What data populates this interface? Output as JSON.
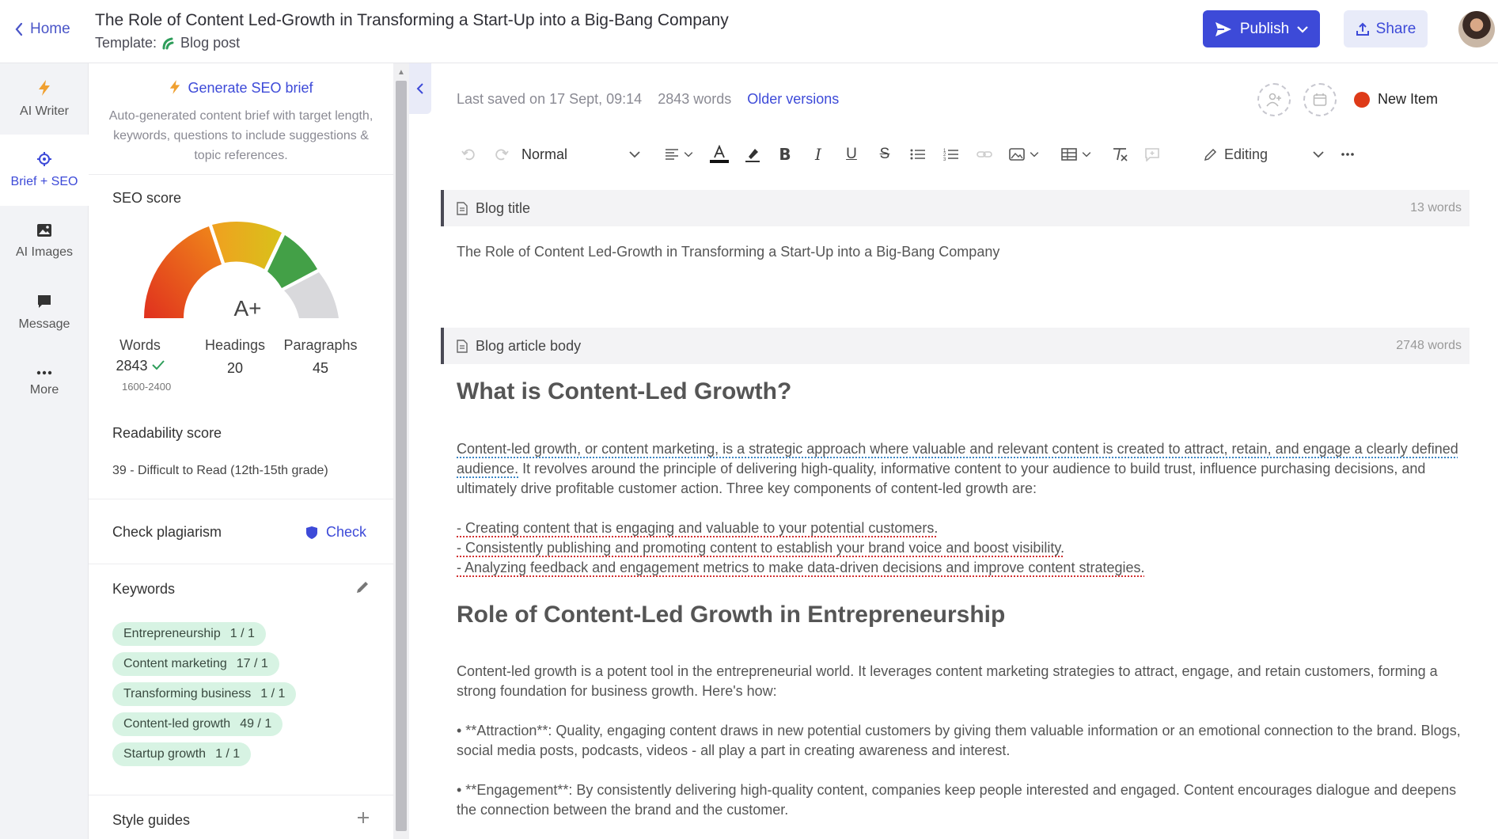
{
  "header": {
    "home_label": "Home",
    "doc_title": "The Role of Content Led-Growth in Transforming a Start-Up into a Big-Bang Company",
    "template_prefix": "Template:",
    "template_name": "Blog post",
    "publish_label": "Publish",
    "share_label": "Share"
  },
  "rail": {
    "items": [
      {
        "label": "AI Writer",
        "icon": "bolt-icon"
      },
      {
        "label": "Brief + SEO",
        "icon": "target-icon"
      },
      {
        "label": "AI Images",
        "icon": "image-icon"
      },
      {
        "label": "Message",
        "icon": "chat-icon"
      },
      {
        "label": "More",
        "icon": "more-icon"
      }
    ],
    "active": "Brief + SEO"
  },
  "panel": {
    "generate_label": "Generate SEO brief",
    "generate_desc": "Auto-generated content brief with target length, keywords, questions to include suggestions & topic references.",
    "seo_title": "SEO score",
    "grade": "A+",
    "stats": {
      "words_label": "Words",
      "words_value": "2843",
      "words_range": "1600-2400",
      "headings_label": "Headings",
      "headings_value": "20",
      "paragraphs_label": "Paragraphs",
      "paragraphs_value": "45"
    },
    "readability_title": "Readability score",
    "readability_value": "39 - Difficult to Read (12th-15th grade)",
    "plagiarism_title": "Check plagiarism",
    "plagiarism_action": "Check",
    "keywords_title": "Keywords",
    "keywords": [
      {
        "name": "Entrepreneurship",
        "count": "1 / 1"
      },
      {
        "name": "Content marketing",
        "count": "17 / 1"
      },
      {
        "name": "Transforming business",
        "count": "1 / 1"
      },
      {
        "name": "Content-led growth",
        "count": "49 / 1"
      },
      {
        "name": "Startup growth",
        "count": "1 / 1"
      }
    ],
    "style_guides_title": "Style guides"
  },
  "editor": {
    "last_saved": "Last saved on 17 Sept, 09:14",
    "word_count": "2843 words",
    "older_versions": "Older versions",
    "new_item": "New Item",
    "toolbar": {
      "style_value": "Normal",
      "mode_value": "Editing"
    },
    "blog_title_section": {
      "label": "Blog title",
      "words": "13 words",
      "content": "The Role of Content Led-Growth in Transforming a Start-Up into a Big-Bang Company"
    },
    "body_section": {
      "label": "Blog article body",
      "words": "2748 words"
    },
    "article": {
      "h1": "What is Content-Led Growth?",
      "p1_underlined": "Content-led growth, or content marketing, is a strategic approach where valuable and relevant content is created to attract, retain, and engage a clearly defined audience.",
      "p1_rest": " It revolves around the principle of delivering high-quality, informative content to your audience to build trust, influence purchasing decisions, and ultimately drive profitable customer action. Three key components of content-led growth are:",
      "bullets": [
        "- Creating content that is engaging and valuable to your potential customers.",
        "- Consistently publishing and promoting content to establish your brand voice and boost visibility.",
        "- Analyzing feedback and engagement metrics to make data-driven decisions and improve content strategies."
      ],
      "h2": "Role of Content-Led Growth in Entrepreneurship",
      "p2": "Content-led growth is a potent tool in the entrepreneurial world. It leverages content marketing strategies to attract, engage, and retain customers, forming a strong foundation for business growth. Here's how:",
      "p3": "• **Attraction**: Quality, engaging content draws in new potential customers by giving them valuable information or an emotional connection to the brand. Blogs, social media posts, podcasts, videos - all play a part in creating awareness and interest.",
      "p4": "• **Engagement**: By consistently delivering high-quality content, companies keep people interested and engaged. Content encourages dialogue and deepens the connection between the brand and the customer."
    }
  },
  "colors": {
    "accent": "#3d4ad8",
    "chip_bg": "#d7f3e3",
    "new_item_dot": "#de3a18"
  }
}
